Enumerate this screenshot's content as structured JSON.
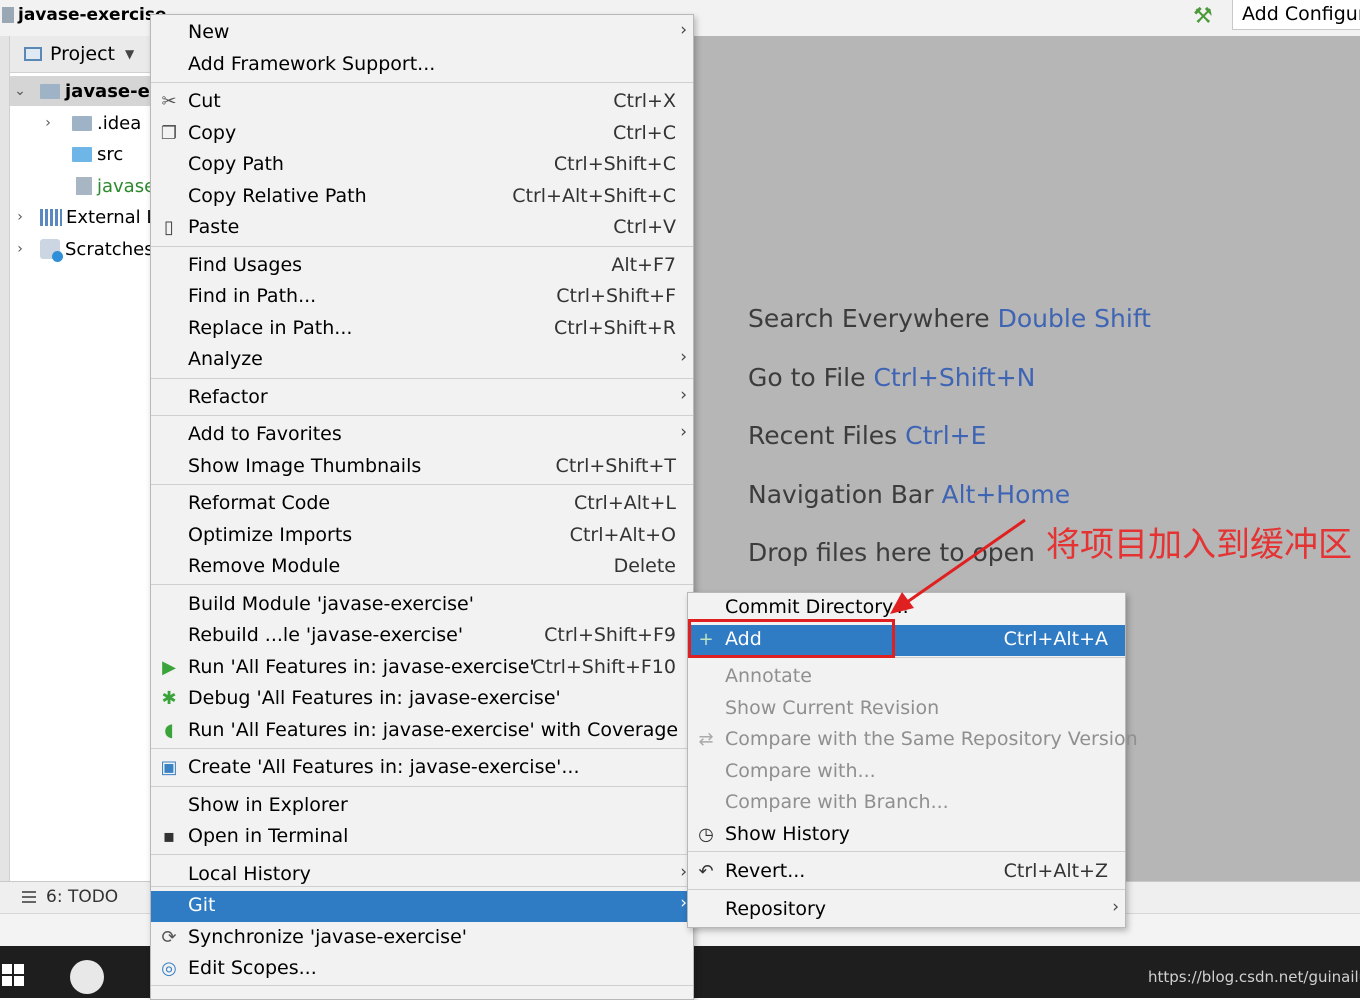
{
  "topbar": {
    "breadcrumb": "javase-exercise",
    "add_config": "Add Configura"
  },
  "project": {
    "header": "Project",
    "tree": [
      {
        "label": "javase-ex",
        "bold": true,
        "arrow": "down"
      },
      {
        "label": ".idea",
        "arrow": "right"
      },
      {
        "label": "src",
        "arrow": ""
      },
      {
        "label": "javase",
        "arrow": ""
      },
      {
        "label": "External L",
        "arrow": "right"
      },
      {
        "label": "Scratches",
        "arrow": "right"
      }
    ]
  },
  "editor_hints": [
    {
      "text": "Search Everywhere",
      "key": "Double Shift"
    },
    {
      "text": "Go to File",
      "key": "Ctrl+Shift+N"
    },
    {
      "text": "Recent Files",
      "key": "Ctrl+E"
    },
    {
      "text": "Navigation Bar",
      "key": "Alt+Home"
    },
    {
      "text": "Drop files here to open",
      "key": ""
    }
  ],
  "context_menu": [
    {
      "label": "New",
      "submenu": true
    },
    {
      "label": "Add Framework Support..."
    },
    {
      "label": "Cut",
      "shortcut": "Ctrl+X",
      "icon": "scissors-icon"
    },
    {
      "label": "Copy",
      "shortcut": "Ctrl+C",
      "icon": "copy-icon"
    },
    {
      "label": "Copy Path",
      "shortcut": "Ctrl+Shift+C"
    },
    {
      "label": "Copy Relative Path",
      "shortcut": "Ctrl+Alt+Shift+C"
    },
    {
      "label": "Paste",
      "shortcut": "Ctrl+V",
      "icon": "paste-icon"
    },
    {
      "label": "Find Usages",
      "shortcut": "Alt+F7"
    },
    {
      "label": "Find in Path...",
      "shortcut": "Ctrl+Shift+F"
    },
    {
      "label": "Replace in Path...",
      "shortcut": "Ctrl+Shift+R"
    },
    {
      "label": "Analyze",
      "submenu": true
    },
    {
      "label": "Refactor",
      "submenu": true
    },
    {
      "label": "Add to Favorites",
      "submenu": true
    },
    {
      "label": "Show Image Thumbnails",
      "shortcut": "Ctrl+Shift+T"
    },
    {
      "label": "Reformat Code",
      "shortcut": "Ctrl+Alt+L"
    },
    {
      "label": "Optimize Imports",
      "shortcut": "Ctrl+Alt+O"
    },
    {
      "label": "Remove Module",
      "shortcut": "Delete"
    },
    {
      "label": "Build Module 'javase-exercise'"
    },
    {
      "label": "Rebuild ...le 'javase-exercise'",
      "shortcut": "Ctrl+Shift+F9"
    },
    {
      "label": "Run 'All Features in: javase-exercise'",
      "shortcut": "Ctrl+Shift+F10",
      "icon": "run-icon"
    },
    {
      "label": "Debug 'All Features in: javase-exercise'",
      "icon": "debug-icon"
    },
    {
      "label": "Run 'All Features in: javase-exercise' with Coverage",
      "icon": "coverage-icon"
    },
    {
      "label": "Create 'All Features in: javase-exercise'...",
      "icon": "create-config-icon"
    },
    {
      "label": "Show in Explorer"
    },
    {
      "label": "Open in Terminal",
      "icon": "terminal-icon"
    },
    {
      "label": "Local History",
      "submenu": true
    },
    {
      "label": "Git",
      "submenu": true,
      "selected": true
    },
    {
      "label": "Synchronize 'javase-exercise'",
      "icon": "sync-icon"
    },
    {
      "label": "Edit Scopes...",
      "icon": "scopes-icon"
    }
  ],
  "git_submenu": [
    {
      "label": "Commit Directory..."
    },
    {
      "label": "Add",
      "shortcut": "Ctrl+Alt+A",
      "selected": true,
      "icon": "plus-icon"
    },
    {
      "label": "Annotate",
      "disabled": true
    },
    {
      "label": "Show Current Revision",
      "disabled": true
    },
    {
      "label": "Compare with the Same Repository Version",
      "disabled": true,
      "icon": "compare-icon"
    },
    {
      "label": "Compare with...",
      "disabled": true
    },
    {
      "label": "Compare with Branch...",
      "disabled": true
    },
    {
      "label": "Show History",
      "icon": "clock-icon"
    },
    {
      "label": "Revert...",
      "shortcut": "Ctrl+Alt+Z",
      "icon": "revert-icon"
    },
    {
      "label": "Repository",
      "submenu": true
    }
  ],
  "annotation": "将项目加入到缓冲区",
  "bottombar": {
    "todo": "6: TODO"
  },
  "watermark": "https://blog.csdn.net/guinailu",
  "colors": {
    "selection": "#2f7bc4",
    "annotation_red": "#e02020",
    "hint_key": "#3e64b4"
  }
}
